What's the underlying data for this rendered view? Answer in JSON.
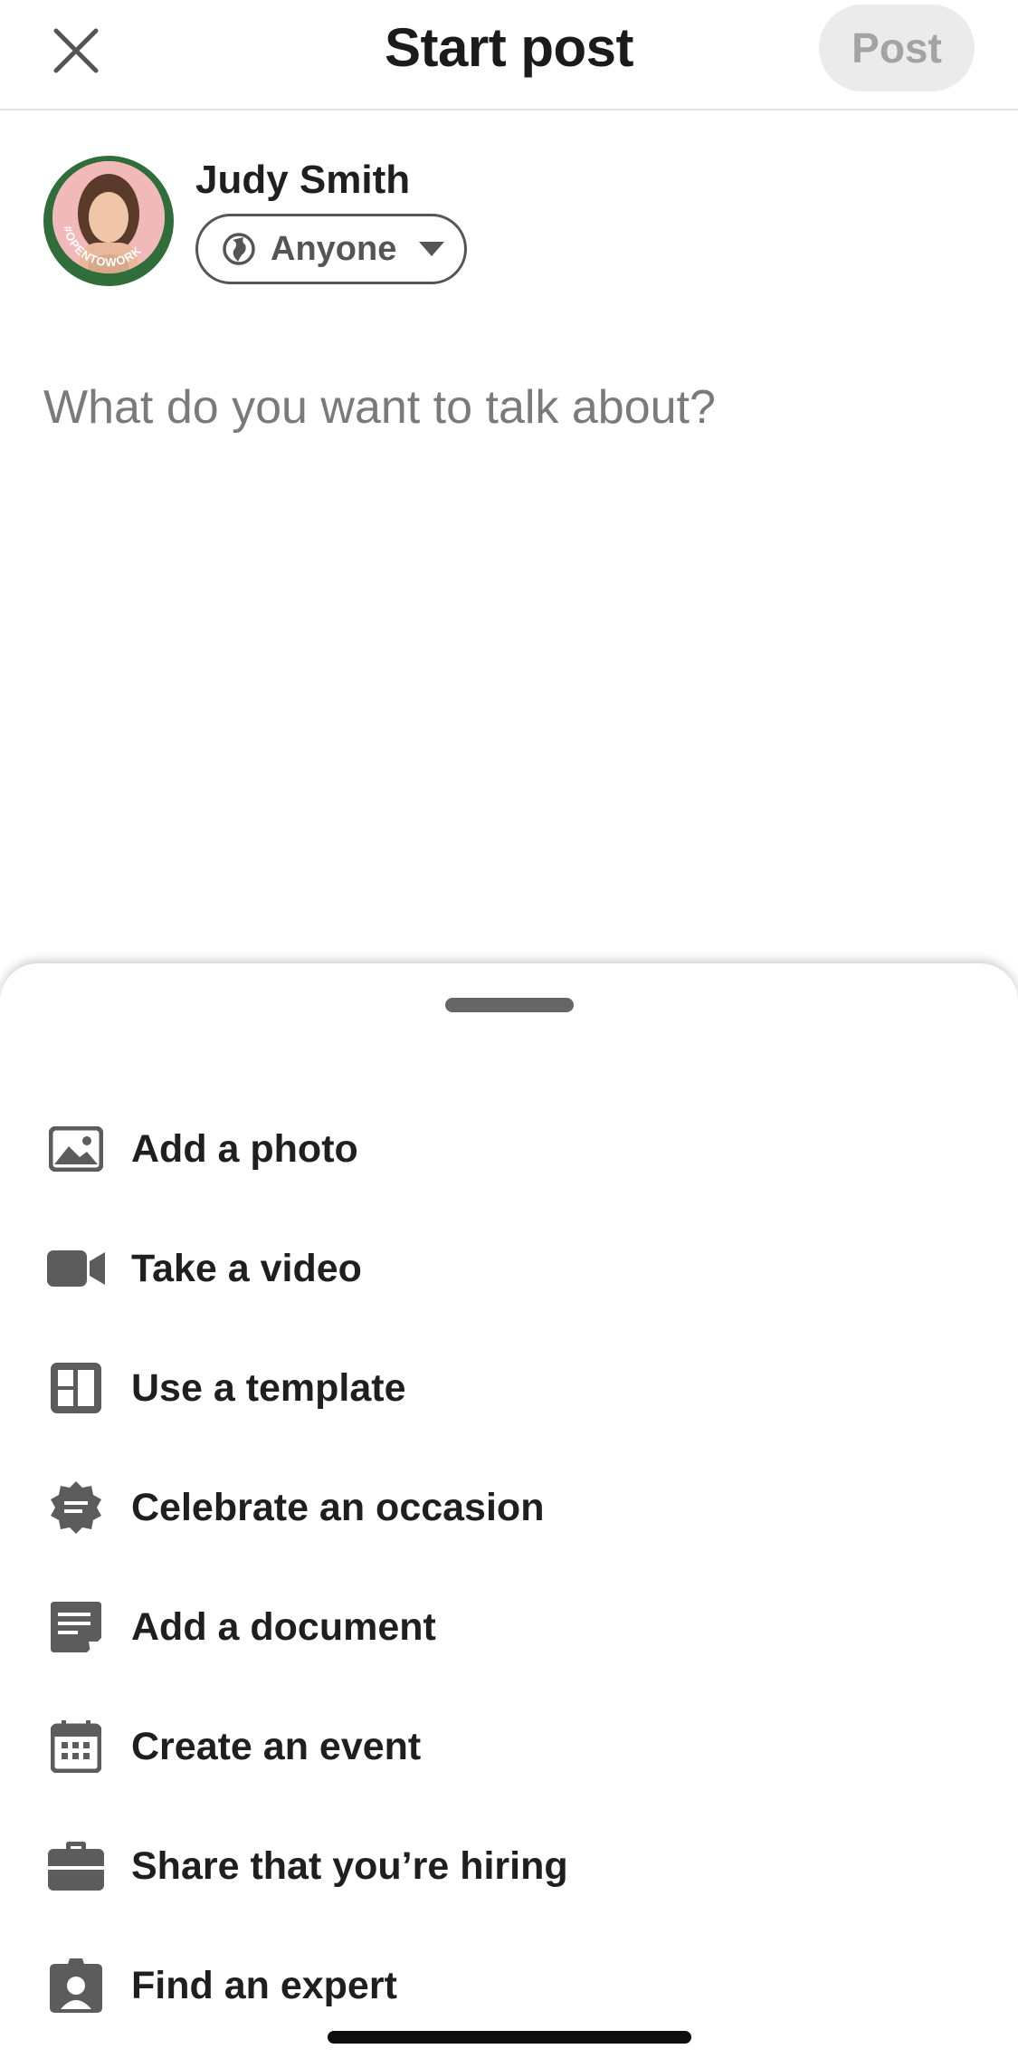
{
  "header": {
    "title": "Start post",
    "post_label": "Post",
    "close_icon": "close-icon"
  },
  "author": {
    "name": "Judy Smith",
    "avatar_badge": "#OPENTOWORK",
    "visibility_label": "Anyone",
    "visibility_icon": "globe-icon"
  },
  "composer": {
    "placeholder": "What do you want to talk about?"
  },
  "menu": {
    "items": [
      {
        "label": "Add a photo",
        "icon": "photo-icon"
      },
      {
        "label": "Take a video",
        "icon": "video-icon"
      },
      {
        "label": "Use a template",
        "icon": "template-icon"
      },
      {
        "label": "Celebrate an occasion",
        "icon": "celebrate-badge-icon"
      },
      {
        "label": "Add a document",
        "icon": "document-icon"
      },
      {
        "label": "Create an event",
        "icon": "calendar-icon"
      },
      {
        "label": "Share that you’re hiring",
        "icon": "briefcase-icon"
      },
      {
        "label": "Find an expert",
        "icon": "expert-icon"
      }
    ]
  },
  "colors": {
    "text": "#1f1f1f",
    "icon": "#5c5c5c",
    "post_button_bg": "#ebebeb",
    "post_button_text": "#a3a3a3",
    "avatar_ring": "#2f6d3a"
  }
}
